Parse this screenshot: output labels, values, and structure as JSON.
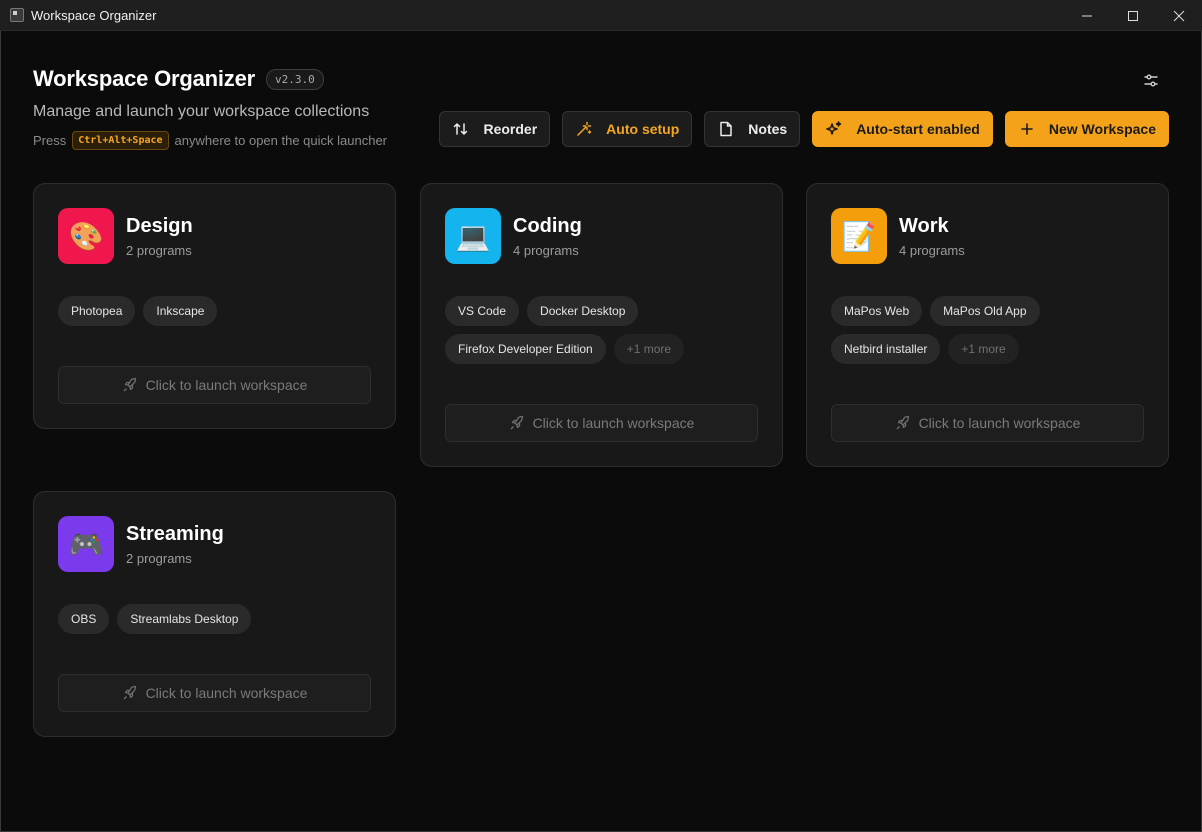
{
  "window": {
    "title": "Workspace Organizer"
  },
  "header": {
    "title": "Workspace Organizer",
    "version": "v2.3.0",
    "subtitle": "Manage and launch your workspace collections",
    "hint_prefix": "Press",
    "hint_shortcut": "Ctrl+Alt+Space",
    "hint_suffix": "anywhere to open the quick launcher"
  },
  "toolbar": {
    "reorder_label": "Reorder",
    "auto_setup_label": "Auto setup",
    "notes_label": "Notes",
    "autostart_label": "Auto-start enabled",
    "new_workspace_label": "New Workspace"
  },
  "colors": {
    "accent": "#f5a21b",
    "design": "#f0174f",
    "coding": "#14b4ee",
    "work": "#f59e0b",
    "streaming": "#7c3aed"
  },
  "launch_label": "Click to launch workspace",
  "workspaces": [
    {
      "name": "Design",
      "count": "2 programs",
      "icon": "palette-icon",
      "glyph": "🎨",
      "programs": [
        "Photopea",
        "Inkscape"
      ]
    },
    {
      "name": "Coding",
      "count": "4 programs",
      "icon": "laptop-icon",
      "glyph": "💻",
      "programs": [
        "VS Code",
        "Docker Desktop",
        "Firefox Developer Edition"
      ],
      "more": "+1 more"
    },
    {
      "name": "Work",
      "count": "4 programs",
      "icon": "memo-icon",
      "glyph": "📝",
      "programs": [
        "MaPos Web",
        "MaPos Old App",
        "Netbird installer"
      ],
      "more": "+1 more"
    },
    {
      "name": "Streaming",
      "count": "2 programs",
      "icon": "gamepad-icon",
      "glyph": "🎮",
      "programs": [
        "OBS",
        "Streamlabs Desktop"
      ]
    }
  ]
}
